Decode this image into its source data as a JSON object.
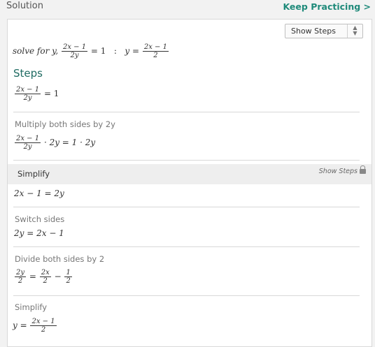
{
  "header": {
    "title": "Solution",
    "keep_practicing": "Keep Practicing >"
  },
  "toolbar": {
    "show_steps_select": "Show Steps"
  },
  "summary": {
    "prefix": "solve for y,",
    "eq_num": "2x − 1",
    "eq_den": "2y",
    "eq_rhs": "= 1",
    "colon": ":",
    "result_lhs": "y =",
    "result_num": "2x − 1",
    "result_den": "2"
  },
  "steps_heading": "Steps",
  "step0": {
    "num": "2x − 1",
    "den": "2y",
    "rhs": "= 1"
  },
  "step1": {
    "label": "Multiply both sides by 2y",
    "num": "2x − 1",
    "den": "2y",
    "rest": "·  2y = 1 ·  2y"
  },
  "step2": {
    "label": "Simplify",
    "show_steps": "Show Steps",
    "math": "2x − 1 = 2y"
  },
  "step3": {
    "label": "Switch sides",
    "math": "2y = 2x − 1"
  },
  "step4": {
    "label": "Divide both sides by 2",
    "a_num": "2y",
    "a_den": "2",
    "eq": "=",
    "b_num": "2x",
    "b_den": "2",
    "minus": "−",
    "c_num": "1",
    "c_den": "2"
  },
  "step5": {
    "label": "Simplify",
    "lhs": "y =",
    "num": "2x − 1",
    "den": "2"
  },
  "colors": {
    "accent": "#1f8a7a",
    "heading": "#1f6b62"
  },
  "icons": {
    "select_arrows": "up-down-arrows-icon",
    "lock": "lock-icon"
  }
}
